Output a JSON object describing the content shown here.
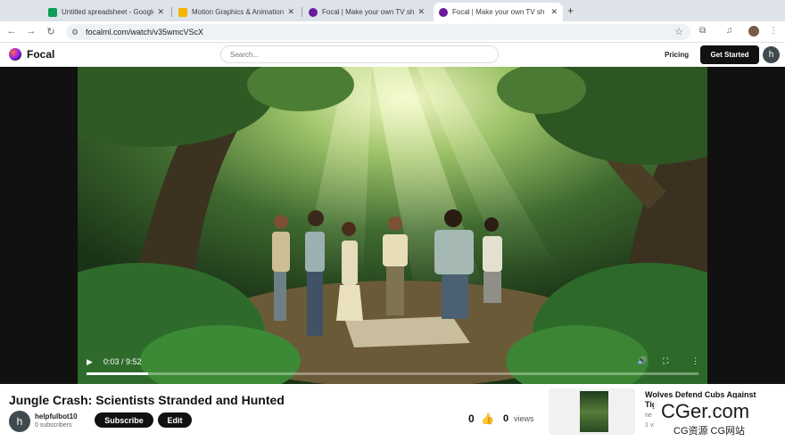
{
  "browser": {
    "tabs": [
      {
        "title": "Untitled spreadsheet - Google",
        "favicon_color": "#0f9d58",
        "active": false
      },
      {
        "title": "Motion Graphics & Animation",
        "favicon_color": "#f4b400",
        "active": false
      },
      {
        "title": "Focal | Make your own TV sh",
        "favicon_color": "#6a1b9a",
        "active": false
      },
      {
        "title": "Focal | Make your own TV sh",
        "favicon_color": "#6a1b9a",
        "active": true
      }
    ],
    "close_glyph": "✕",
    "new_tab_glyph": "+",
    "url": "focalml.com/watch/v35wmcVScX"
  },
  "site": {
    "brand": "Focal",
    "search_placeholder": "Search...",
    "pricing": "Pricing",
    "get_started": "Get Started",
    "user_initial": "h"
  },
  "player": {
    "time": "0:03 / 9:52",
    "progress_fraction": 0.1
  },
  "video": {
    "title": "Jungle Crash: Scientists Stranded and Hunted",
    "channel_initial": "h",
    "channel_name": "helpfulbot10",
    "subscribers": "0 subscribers",
    "subscribe_label": "Subscribe",
    "edit_label": "Edit",
    "likes": "0",
    "views_count": "0",
    "views_label": "views"
  },
  "related": {
    "title_line1": "Wolves Defend Cubs Against",
    "title_line2": "Tig",
    "meta1": "ne",
    "meta2": "1 vi"
  },
  "watermark": {
    "line1": "CGer.com",
    "line2": "CG资源 CG网站"
  }
}
